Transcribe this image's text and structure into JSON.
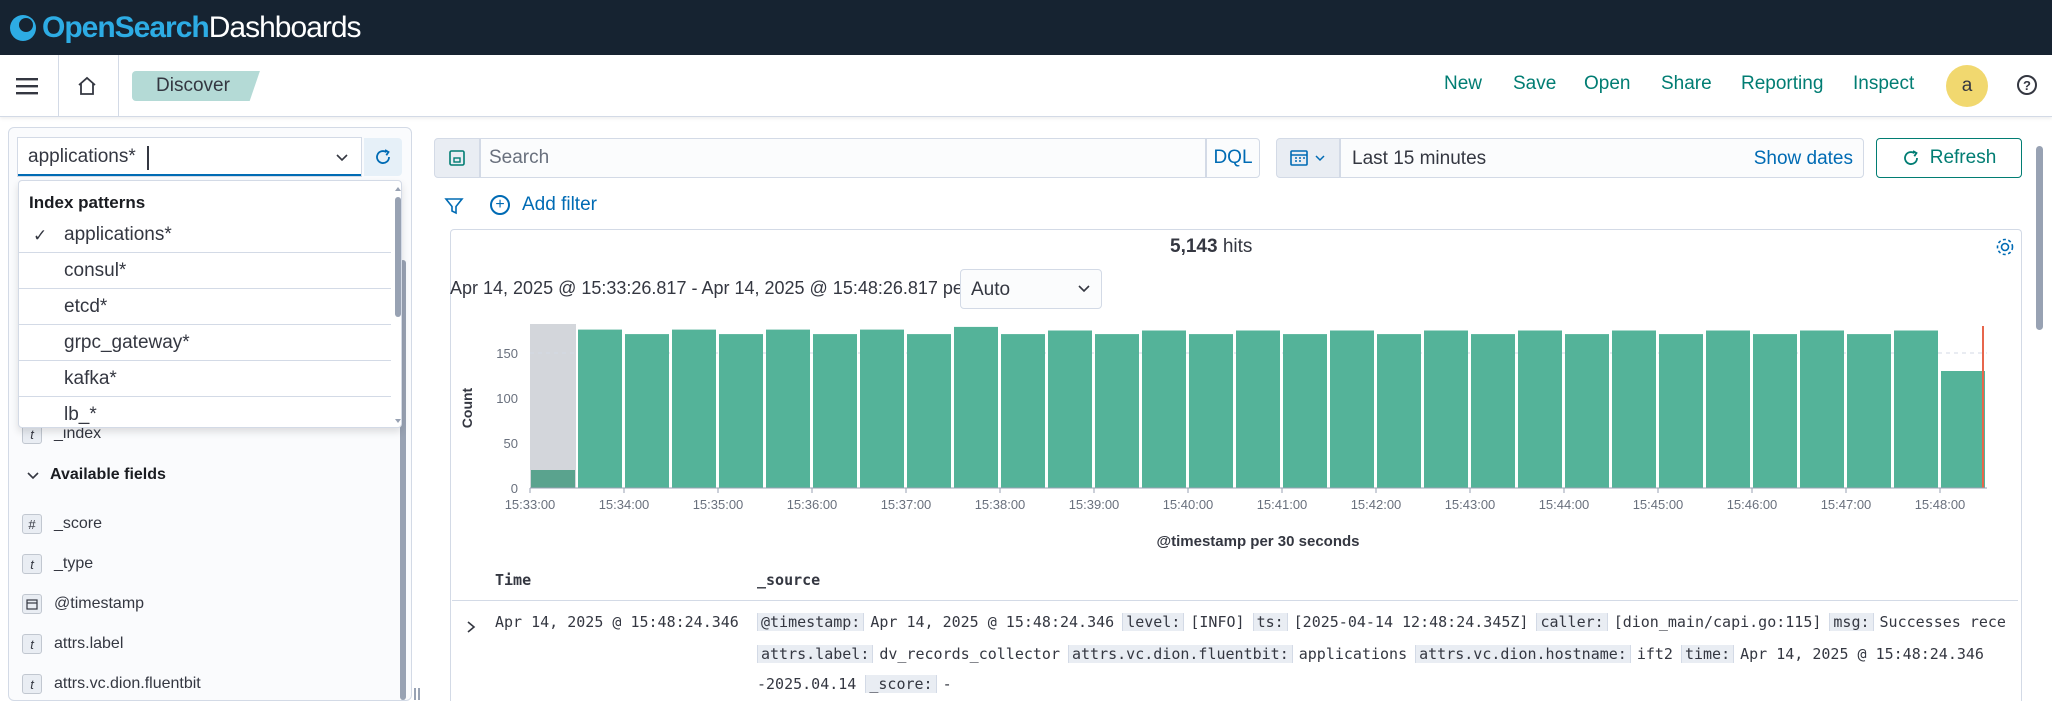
{
  "header": {
    "brand": "OpenSearch",
    "product": "Dashboards"
  },
  "navbar": {
    "breadcrumb": "Discover",
    "links": [
      "New",
      "Save",
      "Open",
      "Share",
      "Reporting",
      "Inspect"
    ],
    "avatar": "a",
    "help": "?"
  },
  "index_pattern": {
    "value": "applications*",
    "dropdown_title": "Index patterns",
    "options": [
      {
        "label": "applications*",
        "selected": true
      },
      {
        "label": "consul*",
        "selected": false
      },
      {
        "label": "etcd*",
        "selected": false
      },
      {
        "label": "grpc_gateway*",
        "selected": false
      },
      {
        "label": "kafka*",
        "selected": false
      },
      {
        "label": "lb_*",
        "selected": false
      }
    ]
  },
  "fields": {
    "selected_partial": {
      "type": "t",
      "name": "_index"
    },
    "available_title": "Available fields",
    "available": [
      {
        "type": "#",
        "name": "_score"
      },
      {
        "type": "t",
        "name": "_type"
      },
      {
        "type": "calendar",
        "name": "@timestamp"
      },
      {
        "type": "t",
        "name": "attrs.label"
      },
      {
        "type": "t",
        "name": "attrs.vc.dion.fluentbit"
      }
    ]
  },
  "query": {
    "placeholder": "Search",
    "language": "DQL"
  },
  "time": {
    "range": "Last 15 minutes",
    "show_dates": "Show dates",
    "refresh": "Refresh"
  },
  "filter": {
    "add_label": "Add filter"
  },
  "results": {
    "hits_count": "5,143",
    "hits_label": "hits",
    "range_text": "Apr 14, 2025 @ 15:33:26.817 - Apr 14, 2025 @ 15:48:26.817 per",
    "interval": "Auto"
  },
  "chart_data": {
    "type": "bar",
    "xlabel": "@timestamp per 30 seconds",
    "ylabel": "Count",
    "ylim": [
      0,
      180
    ],
    "yticks": [
      0,
      50,
      100,
      150
    ],
    "x_tick_labels": [
      "15:33:00",
      "15:34:00",
      "15:35:00",
      "15:36:00",
      "15:37:00",
      "15:38:00",
      "15:39:00",
      "15:40:00",
      "15:41:00",
      "15:42:00",
      "15:43:00",
      "15:44:00",
      "15:45:00",
      "15:46:00",
      "15:47:00",
      "15:48:00"
    ],
    "categories": [
      "15:33:00",
      "15:33:30",
      "15:34:00",
      "15:34:30",
      "15:35:00",
      "15:35:30",
      "15:36:00",
      "15:36:30",
      "15:37:00",
      "15:37:30",
      "15:38:00",
      "15:38:30",
      "15:39:00",
      "15:39:30",
      "15:40:00",
      "15:40:30",
      "15:41:00",
      "15:41:30",
      "15:42:00",
      "15:42:30",
      "15:43:00",
      "15:43:30",
      "15:44:00",
      "15:44:30",
      "15:45:00",
      "15:45:30",
      "15:46:00",
      "15:46:30",
      "15:47:00",
      "15:47:30",
      "15:48:00"
    ],
    "values": [
      20,
      176,
      171,
      176,
      171,
      176,
      171,
      176,
      171,
      179,
      171,
      175,
      171,
      175,
      171,
      175,
      171,
      175,
      171,
      175,
      171,
      175,
      171,
      175,
      171,
      175,
      171,
      175,
      171,
      175,
      130
    ],
    "partial_bucket_before": "15:33:26.817",
    "colors": {
      "bar": "#54b399",
      "bar_partial": "#5aa38e",
      "current_time": "#e7664c",
      "partial_bg": "#d3d6db"
    }
  },
  "table": {
    "headers": [
      "Time",
      "_source"
    ],
    "rows": [
      {
        "time": "Apr 14, 2025 @ 15:48:24.346",
        "line1": [
          [
            "@timestamp:",
            "Apr 14, 2025 @ 15:48:24.346"
          ],
          [
            "level:",
            "[INFO]"
          ],
          [
            "ts:",
            "[2025-04-14 12:48:24.345Z]"
          ],
          [
            "caller:",
            "[dion_main/capi.go:115]"
          ],
          [
            "msg:",
            "Successes rece"
          ]
        ],
        "line2": [
          [
            "attrs.label:",
            "dv_records_collector"
          ],
          [
            "attrs.vc.dion.fluentbit:",
            "applications"
          ],
          [
            "attrs.vc.dion.hostname:",
            "ift2"
          ],
          [
            "time:",
            "Apr 14, 2025 @ 15:48:24.346"
          ]
        ],
        "line3_prefix": "-2025.04.14",
        "line3": [
          [
            "_score:",
            "-"
          ]
        ]
      }
    ]
  }
}
